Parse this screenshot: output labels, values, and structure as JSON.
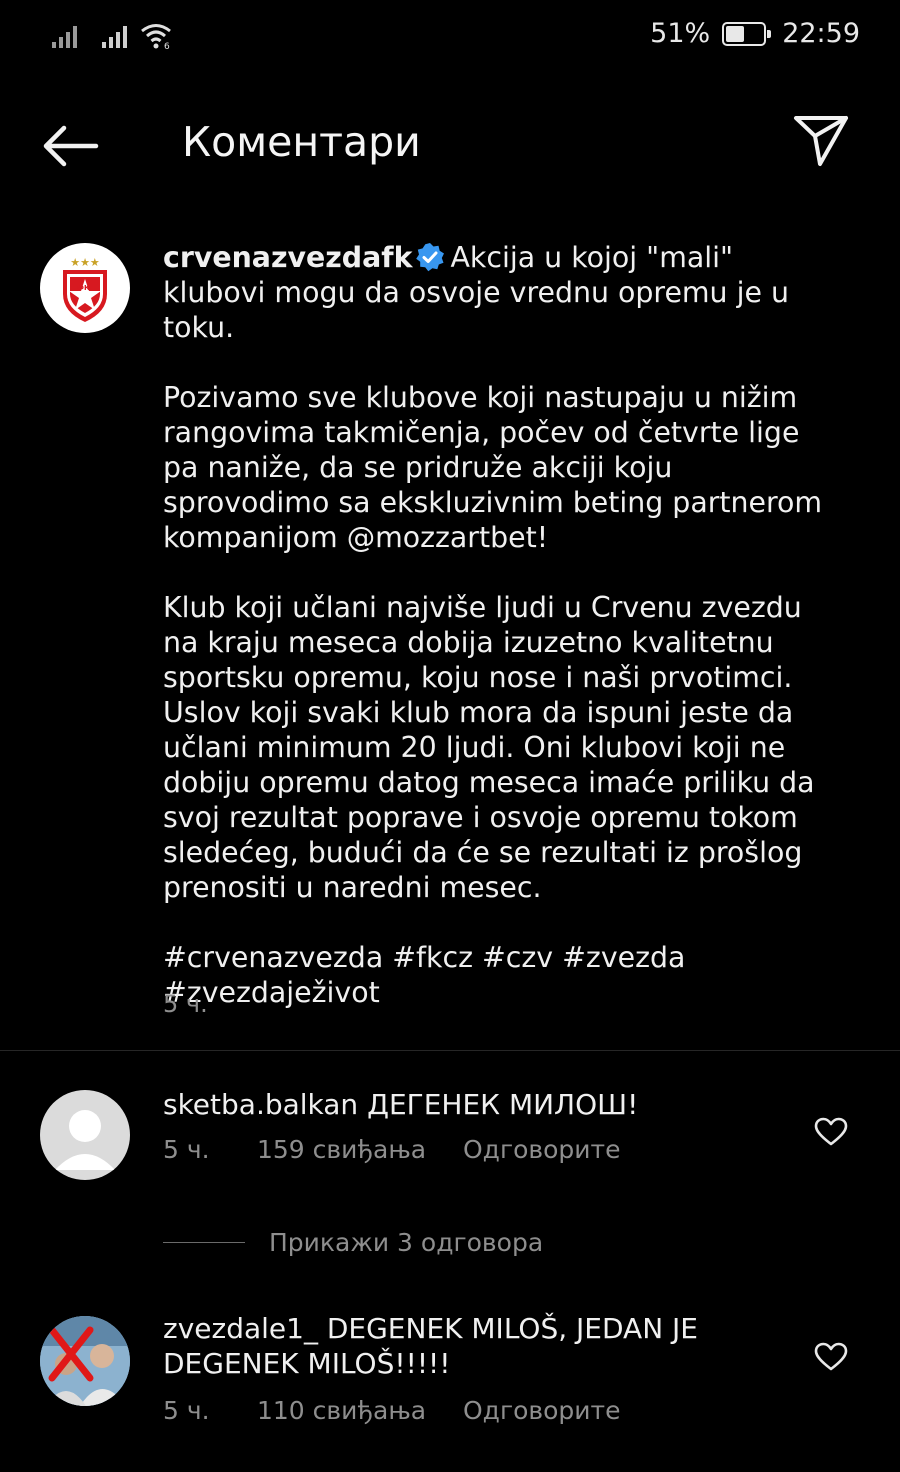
{
  "status_bar": {
    "battery_percent": "51%",
    "battery_level": 0.51,
    "time": "22:59"
  },
  "header": {
    "title": "Коментари",
    "back_icon": "arrow-left-icon",
    "share_icon": "paper-plane-icon"
  },
  "post": {
    "username": "crvenazvezdafk",
    "verified": true,
    "paragraphs": [
      "Akcija u kojoj \"mali\" klubovi mogu da osvoje vrednu opremu je u toku.",
      "Pozivamo sve klubove koji nastupaju u nižim rangovima takmičenja, počev od četvrte lige pa naniže, da se pridruže akciji koju sprovodimo sa ekskluzivnim beting partnerom kompanijom @mozzartbet!",
      "Klub koji učlani najviše ljudi u Crvenu zvezdu na kraju meseca dobija izuzetno kvalitetnu sportsku opremu, koju nose i naši prvotimci. Uslov koji svaki klub mora da ispuni jeste da učlani minimum 20 ljudi. Oni klubovi koji ne dobiju opremu datog meseca imaće priliku da svoj rezultat poprave i osvoje opremu tokom sledećeg, budući da će se rezultati iz prošlog prenositi u naredni mesec.",
      "#crvenazvezda #fkcz #czv #zvezda #zvezdaježivot"
    ],
    "time": "5 ч."
  },
  "comments": [
    {
      "username": "sketba.balkan",
      "text": "ДЕГЕНЕК МИЛОШ!",
      "time": "5 ч.",
      "likes": "159 свиђања",
      "reply_label": "Одговорите",
      "view_replies": "Прикажи 3 одговора"
    },
    {
      "username": "zvezdale1_",
      "text": "DEGENEK MILOŠ, JEDAN JE DEGENEK MILOŠ!!!!!",
      "time": "5 ч.",
      "likes": "110 свиђања",
      "reply_label": "Одговорите"
    }
  ],
  "colors": {
    "background": "#000000",
    "text": "#f0f0f0",
    "secondary_text": "#8e8e8e",
    "verified_blue": "#3897f0",
    "club_red": "#d71920"
  }
}
